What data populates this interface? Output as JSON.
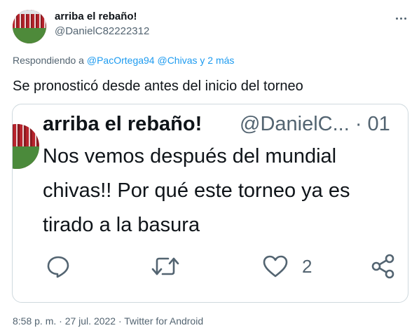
{
  "author": {
    "name": "arriba el rebaño!",
    "handle": "@DanielC82222312"
  },
  "reply": {
    "prefix": "Respondiendo a",
    "mention_1": "@PacOrtega94",
    "mention_2": "@Chivas",
    "conjunction": "y",
    "more": "2 más"
  },
  "tweet": {
    "text": "Se pronosticó desde antes del inicio del torneo"
  },
  "media": {
    "name": "arriba el rebaño!",
    "handle_line": "@DanielC... · 01",
    "text": "Nos vemos después del mundial\nchivas!! Por qué este torneo ya es\ntirado a la basura",
    "icons": [
      "reply-icon",
      "retweet-icon",
      "like-icon",
      "share-icon"
    ],
    "like_count": "2"
  },
  "footer": {
    "meta": "8:58 p. m. · 27 jul. 2022 · Twitter for Android"
  },
  "colors": {
    "text": "#0f1419",
    "secondary": "#536471",
    "link": "#1d9bf0",
    "border": "#cfd9de"
  }
}
